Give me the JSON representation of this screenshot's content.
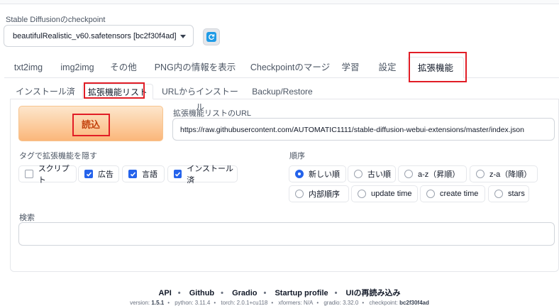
{
  "checkpoint": {
    "label": "Stable Diffusionのcheckpoint",
    "value": "beautifulRealistic_v60.safetensors [bc2f30f4ad]"
  },
  "main_tabs": [
    "txt2img",
    "img2img",
    "その他",
    "PNG内の情報を表示",
    "Checkpointのマージ",
    "学習",
    "設定",
    "拡張機能"
  ],
  "sub_tabs": [
    "インストール済",
    "拡張機能リスト",
    "URLからインストール",
    "Backup/Restore"
  ],
  "load_button": "読込",
  "url": {
    "label": "拡張機能リストのURL",
    "value": "https://raw.githubusercontent.com/AUTOMATIC1111/stable-diffusion-webui-extensions/master/index.json"
  },
  "hide": {
    "label": "タグで拡張機能を隠す",
    "items": [
      {
        "label": "スクリプト",
        "checked": false
      },
      {
        "label": "広告",
        "checked": true
      },
      {
        "label": "言語",
        "checked": true
      },
      {
        "label": "インストール済",
        "checked": true
      }
    ]
  },
  "order": {
    "label": "順序",
    "options": [
      "新しい順",
      "古い順",
      "a-z（昇順）",
      "z-a（降順）",
      "内部順序",
      "update time",
      "create time",
      "stars"
    ],
    "selected": "新しい順"
  },
  "search": {
    "label": "検索",
    "value": ""
  },
  "footer": {
    "links": [
      "API",
      "Github",
      "Gradio",
      "Startup profile",
      "UIの再読み込み"
    ],
    "version": {
      "version_label": "version:",
      "version": "1.5.1",
      "python_label": "python:",
      "python": "3.11.4",
      "torch_label": "torch:",
      "torch": "2.0.1+cu118",
      "xformers_label": "xformers:",
      "xformers": "N/A",
      "gradio_label": "gradio:",
      "gradio": "3.32.0",
      "checkpoint_label": "checkpoint:",
      "checkpoint": "bc2f30f4ad"
    }
  },
  "colors": {
    "accent": "#2563eb",
    "highlight": "#e11d26",
    "load_button": "#fbb77a"
  }
}
